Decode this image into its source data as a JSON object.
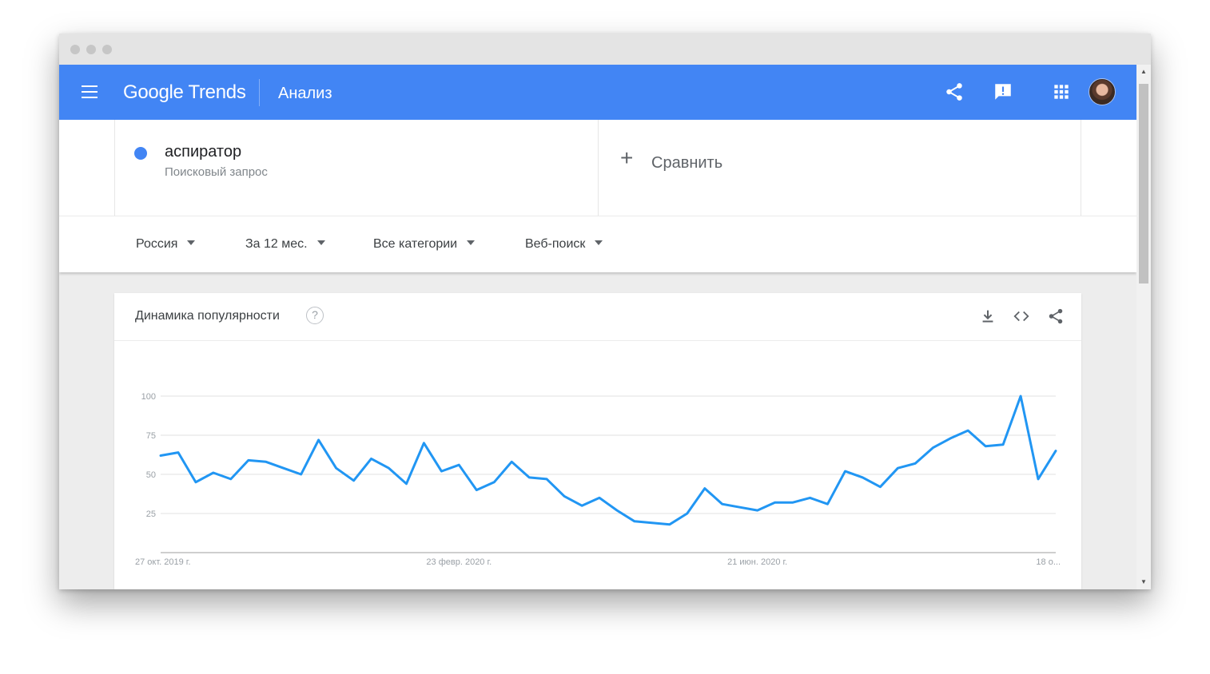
{
  "app": {
    "logo": "Google Trends",
    "page_title": "Анализ"
  },
  "colors": {
    "brand": "#4285f4",
    "series": "#2196f3"
  },
  "icons": [
    "menu-icon",
    "share-icon",
    "feedback-icon",
    "apps-grid-icon",
    "avatar",
    "help-icon",
    "download-icon",
    "embed-code-icon"
  ],
  "search": {
    "term": "аспиратор",
    "term_type": "Поисковый запрос",
    "compare_label": "Сравнить"
  },
  "filters": {
    "region": "Россия",
    "period": "За 12 мес.",
    "category": "Все категории",
    "search_type": "Веб-поиск"
  },
  "chart": {
    "title": "Динамика популярности",
    "help_glyph": "?"
  },
  "chart_data": {
    "type": "line",
    "ylim": [
      0,
      100
    ],
    "y_ticks": [
      "100",
      "75",
      "50",
      "25"
    ],
    "x_tick_labels": [
      {
        "label": "27 окт. 2019 г.",
        "index": 0
      },
      {
        "label": "23 февр. 2020 г.",
        "index": 17
      },
      {
        "label": "21 июн. 2020 г.",
        "index": 34
      },
      {
        "label": "18 о...",
        "index": 51
      }
    ],
    "grid": true,
    "series": [
      {
        "values": [
          62,
          64,
          45,
          51,
          47,
          59,
          58,
          54,
          50,
          72,
          54,
          46,
          60,
          54,
          44,
          70,
          52,
          56,
          40,
          45,
          58,
          48,
          47,
          36,
          30,
          35,
          27,
          20,
          19,
          18,
          25,
          41,
          31,
          29,
          27,
          32,
          32,
          35,
          31,
          52,
          48,
          42,
          54,
          57,
          67,
          73,
          78,
          68,
          69,
          100,
          47,
          65
        ]
      }
    ]
  }
}
